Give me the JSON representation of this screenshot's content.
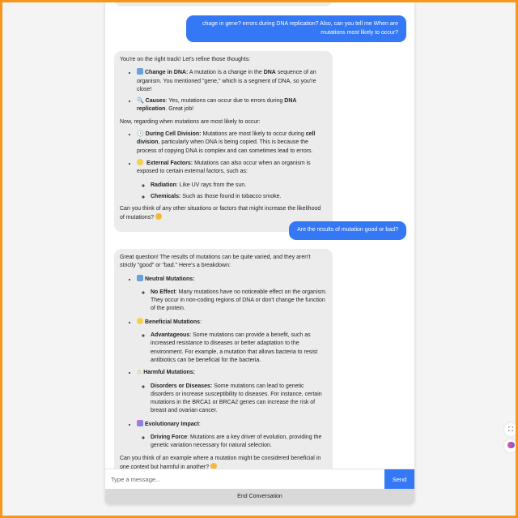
{
  "messages": {
    "user1": "chage in gene? errors during DNA replication? Also, can you tell me When are mutations most likely to occur?",
    "bot1": {
      "intro": "You're on the right track! Let's refine those thoughts:",
      "items": [
        {
          "icon": "arrows-cycle-icon",
          "title": "Change in DNA:",
          "text_a": " A mutation is a change in the ",
          "bold": "DNA",
          "text_b": " sequence of an organism. You mentioned \"gene,\" which is a segment of DNA, so you're close!"
        },
        {
          "icon": "magnifier-icon",
          "title": "Causes",
          "text_a": ": Yes, mutations can occur due to errors during ",
          "bold": "DNA replication",
          "text_b": ". Great job!"
        }
      ],
      "middle": "Now, regarding when mutations are most likely to occur:",
      "items2": [
        {
          "icon": "clock-icon",
          "title": "During Cell Division:",
          "text_a": " Mutations are most likely to occur during ",
          "bold": "cell division",
          "text_b": ", particularly when DNA is being copied. This is because the process of copying DNA is complex and can sometimes lead to errors."
        },
        {
          "icon": "sun-icon",
          "title": "External Factors:",
          "text_a": " Mutations can also occur when an organism is exposed to certain external factors, such as:"
        }
      ],
      "sub": [
        {
          "title": "Radiation",
          "text": ": Like UV rays from the sun."
        },
        {
          "title": "Chemicals:",
          "text": " Such as those found in tobacco smoke."
        }
      ],
      "outro": "Can you think of any other situations or factors that might increase the likelihood of mutations?"
    },
    "user2": "Are the results of mutation good or bad?",
    "bot2": {
      "intro": "Great question! The results of mutations can be quite varied, and they aren't strictly \"good\" or \"bad.\" Here's a breakdown:",
      "sections": [
        {
          "icon": "arrows-cycle-icon",
          "title": "Neutral Mutations:",
          "sub_title": "No Effect",
          "sub_text": ": Many mutations have no noticeable effect on the organism. They occur in non-coding regions of DNA or don't change the function of the protein."
        },
        {
          "icon": "sun-icon",
          "title": "Beneficial Mutations",
          "title_suffix": ":",
          "sub_title": "Advantageous",
          "sub_text": ": Some mutations can provide a benefit, such as increased resistance to diseases or better adaptation to the environment. For example, a mutation that allows bacteria to resist antibiotics can be beneficial for the bacteria."
        },
        {
          "icon": "warning-icon",
          "title": "Harmful Mutations:",
          "sub_title": "Disorders or Diseases:",
          "sub_text": " Some mutations can lead to genetic disorders or increase susceptibility to diseases. For instance, certain mutations in the BRCA1 or BRCA2 genes can increase the risk of breast and ovarian cancer."
        },
        {
          "icon": "dna-icon",
          "title": "Evolutionary Impact",
          "title_suffix": ":",
          "sub_title": "Driving Force",
          "sub_text": ": Mutations are a key driver of evolution, providing the genetic variation necessary for natural selection."
        }
      ],
      "outro": "Can you think of an example where a mutation might be considered beneficial in one context but harmful in another?"
    }
  },
  "input": {
    "placeholder": "Type a message...",
    "value": ""
  },
  "send_label": "Send",
  "end_label": "End Conversation",
  "colors": {
    "accent": "#3478f6",
    "frame": "#f7961c",
    "bubble": "#ececec"
  }
}
